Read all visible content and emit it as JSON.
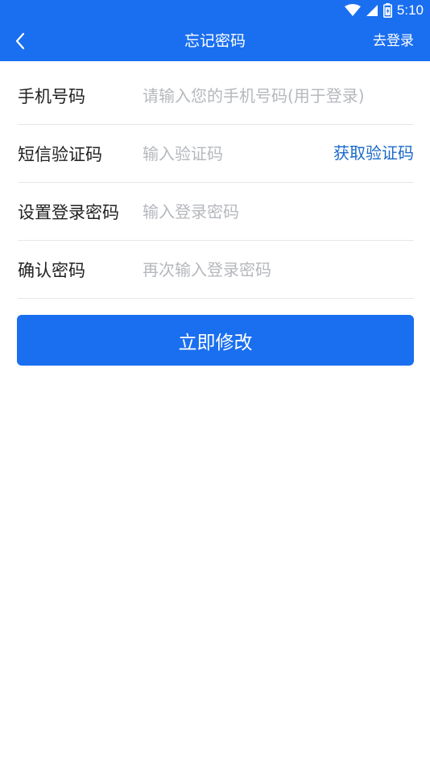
{
  "status_bar": {
    "time": "5:10",
    "icons": [
      "wifi-icon",
      "cell-signal-icon",
      "battery-icon"
    ]
  },
  "app_bar": {
    "title": "忘记密码",
    "right_link": "去登录",
    "back_icon": "chevron-left-icon"
  },
  "form": {
    "phone": {
      "label": "手机号码",
      "placeholder": "请输入您的手机号码(用于登录)",
      "value": ""
    },
    "sms_code": {
      "label": "短信验证码",
      "placeholder": "输入验证码",
      "value": "",
      "button": "获取验证码"
    },
    "password": {
      "label": "设置登录密码",
      "placeholder": "输入登录密码",
      "value": ""
    },
    "confirm_password": {
      "label": "确认密码",
      "placeholder": "再次输入登录密码",
      "value": ""
    }
  },
  "submit_label": "立即修改",
  "colors": {
    "primary": "#1a6ff0",
    "link": "#1a6ac9",
    "placeholder": "#b5b8bd",
    "divider": "#e6e6e6"
  }
}
